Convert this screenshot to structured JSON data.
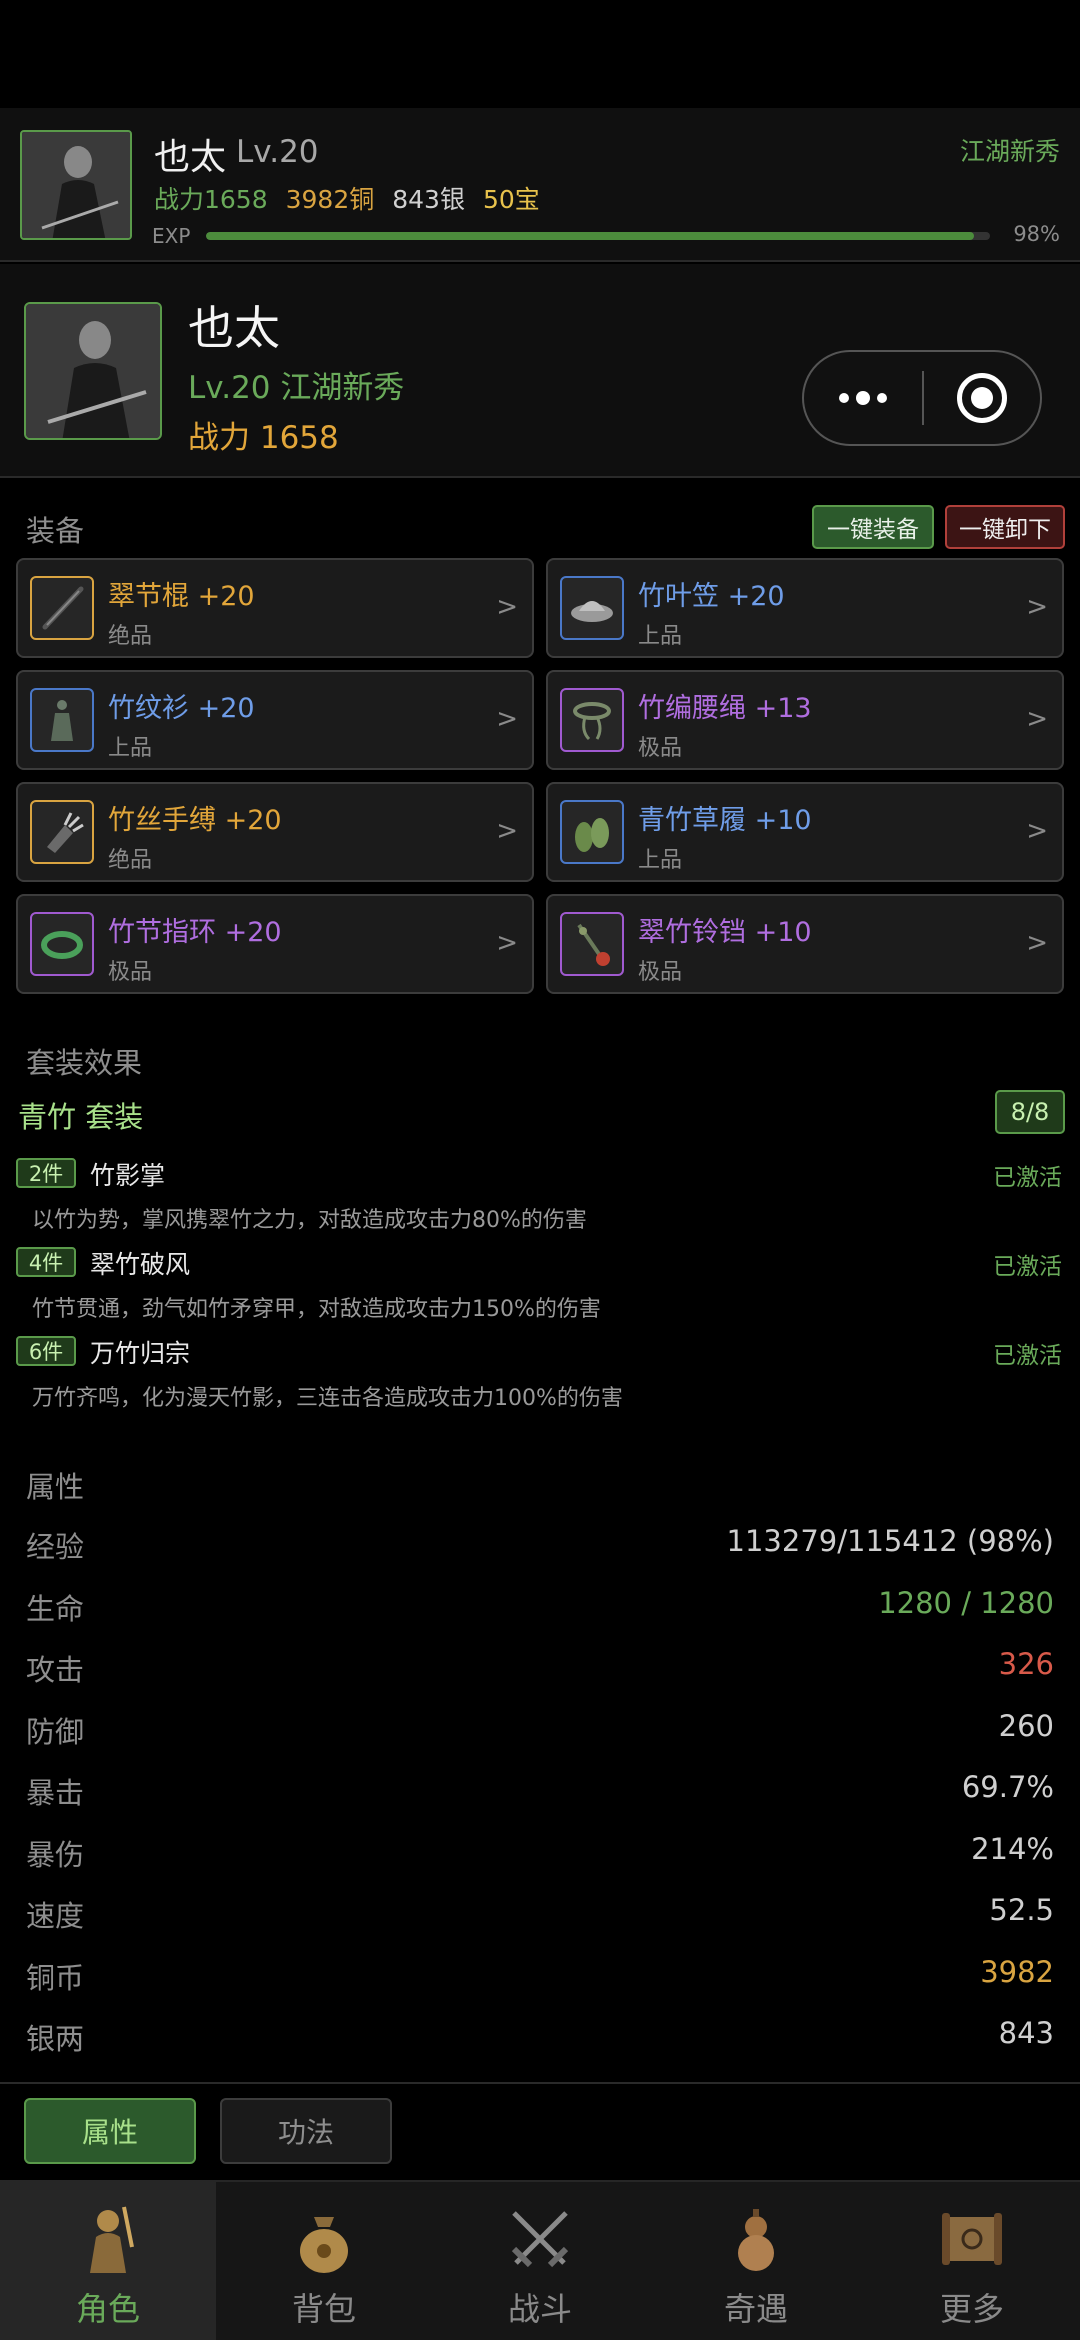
{
  "header": {
    "name": "也太",
    "level": "Lv.20",
    "rank": "江湖新秀",
    "power": "战力1658",
    "copper": "3982铜",
    "silver": "843银",
    "gold": "50宝",
    "exp_label": "EXP",
    "exp_pct": "98%",
    "exp_fraction": 0.98
  },
  "character": {
    "name": "也太",
    "level_rank": "Lv.20 江湖新秀",
    "power": "战力 1658"
  },
  "equipment": {
    "title": "装备",
    "equip_all": "一键装备",
    "unequip_all": "一键卸下",
    "items": [
      {
        "name": "翠节棍 +20",
        "quality": "绝品",
        "icon": "staff-icon"
      },
      {
        "name": "竹叶笠 +20",
        "quality": "上品",
        "icon": "bamboo-hat-icon"
      },
      {
        "name": "竹纹衫 +20",
        "quality": "上品",
        "icon": "robe-icon"
      },
      {
        "name": "竹编腰绳 +13",
        "quality": "极品",
        "icon": "belt-icon"
      },
      {
        "name": "竹丝手缚 +20",
        "quality": "绝品",
        "icon": "bracer-icon"
      },
      {
        "name": "青竹草履 +10",
        "quality": "上品",
        "icon": "sandals-icon"
      },
      {
        "name": "竹节指环 +20",
        "quality": "极品",
        "icon": "ring-icon"
      },
      {
        "name": "翠竹铃铛 +10",
        "quality": "极品",
        "icon": "bell-icon"
      }
    ]
  },
  "set_effect": {
    "title": "套装效果",
    "set_name": "青竹 套装",
    "count": "8/8",
    "tiers": [
      {
        "badge": "2件",
        "name": "竹影掌",
        "status": "已激活",
        "desc": "以竹为势，掌风携翠竹之力，对敌造成攻击力80%的伤害"
      },
      {
        "badge": "4件",
        "name": "翠竹破风",
        "status": "已激活",
        "desc": "竹节贯通，劲气如竹矛穿甲，对敌造成攻击力150%的伤害"
      },
      {
        "badge": "6件",
        "name": "万竹归宗",
        "status": "已激活",
        "desc": "万竹齐鸣，化为漫天竹影，三连击各造成攻击力100%的伤害"
      }
    ]
  },
  "attributes": {
    "title": "属性",
    "rows": [
      {
        "key": "经验",
        "value": "113279/115412 (98%)"
      },
      {
        "key": "生命",
        "value": "1280 / 1280"
      },
      {
        "key": "攻击",
        "value": "326"
      },
      {
        "key": "防御",
        "value": "260"
      },
      {
        "key": "暴击",
        "value": "69.7%"
      },
      {
        "key": "暴伤",
        "value": "214%"
      },
      {
        "key": "速度",
        "value": "52.5"
      },
      {
        "key": "铜币",
        "value": "3982"
      },
      {
        "key": "银两",
        "value": "843"
      }
    ]
  },
  "subtabs": {
    "attributes": "属性",
    "skills": "功法"
  },
  "nav": {
    "items": [
      {
        "label": "角色",
        "icon": "warrior-icon"
      },
      {
        "label": "背包",
        "icon": "money-bag-icon"
      },
      {
        "label": "战斗",
        "icon": "crossed-swords-icon"
      },
      {
        "label": "奇遇",
        "icon": "gourd-icon"
      },
      {
        "label": "更多",
        "icon": "scroll-icon"
      }
    ]
  },
  "colors": {
    "accent_green": "#6aaa5a",
    "gold": "#e2a63a",
    "blue": "#6f9de8",
    "purple": "#b06ee0",
    "red": "#d85a4a"
  }
}
